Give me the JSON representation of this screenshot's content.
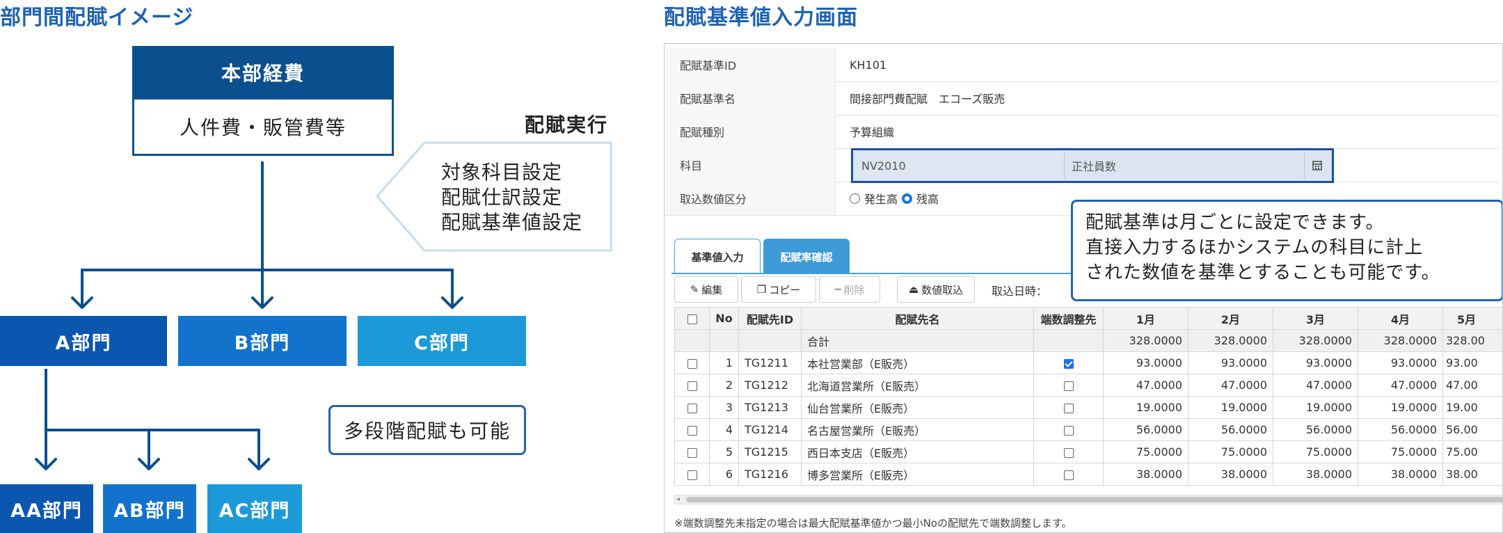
{
  "left": {
    "title": "部門間配賦イメージ",
    "hq": {
      "label": "本部経費",
      "content": "人件費・販管費等"
    },
    "execution_label": "配賦実行",
    "settings": [
      "対象科目設定",
      "配賦仕訳設定",
      "配賦基準値設定"
    ],
    "departments": [
      "A部門",
      "B部門",
      "C部門"
    ],
    "sub_departments": [
      "AA部門",
      "AB部門",
      "AC部門"
    ],
    "multi_stage_note": "多段階配賦も可能",
    "colors": {
      "dark": "#0b4f8e",
      "mid": "#0f6bc4",
      "light": "#1d99d6",
      "arrow": "#0b4f8e"
    }
  },
  "right": {
    "title": "配賦基準値入力画面",
    "form": [
      {
        "label": "配賦基準ID",
        "value": "KH101"
      },
      {
        "label": "配賦基準名",
        "value": "間接部門費配賦　エコーズ販売"
      },
      {
        "label": "配賦種別",
        "value": "予算組織"
      },
      {
        "label": "科目",
        "code": "NV2010",
        "name": "正社員数"
      },
      {
        "label": "取込数値区分",
        "option1": "発生高",
        "option2": "残高"
      }
    ],
    "tabs": [
      "基準値入力",
      "配賦率確認"
    ],
    "toolbar": {
      "edit": "編集",
      "copy": "コピー",
      "delete": "削除",
      "import": "数値取込",
      "import_date_label": "取込日時："
    },
    "callout": [
      "配賦基準は月ごとに設定できます。",
      "直接入力するほかシステムの科目に計上",
      "された数値を基準とすることも可能です。"
    ],
    "table": {
      "headers": [
        "No",
        "配賦先ID",
        "配賦先名",
        "端数調整先",
        "1月",
        "2月",
        "3月",
        "4月",
        "5月"
      ],
      "sum_label": "合計",
      "sum_values": [
        "328.0000",
        "328.0000",
        "328.0000",
        "328.0000",
        "328.00"
      ],
      "rows": [
        {
          "no": "1",
          "id": "TG1211",
          "name": "本社営業部（E販売）",
          "adjust": true,
          "values": [
            "93.0000",
            "93.0000",
            "93.0000",
            "93.0000",
            "93.00"
          ]
        },
        {
          "no": "2",
          "id": "TG1212",
          "name": "北海道営業所（E販売）",
          "adjust": false,
          "values": [
            "47.0000",
            "47.0000",
            "47.0000",
            "47.0000",
            "47.00"
          ]
        },
        {
          "no": "3",
          "id": "TG1213",
          "name": "仙台営業所（E販売）",
          "adjust": false,
          "values": [
            "19.0000",
            "19.0000",
            "19.0000",
            "19.0000",
            "19.00"
          ]
        },
        {
          "no": "4",
          "id": "TG1214",
          "name": "名古屋営業所（E販売）",
          "adjust": false,
          "values": [
            "56.0000",
            "56.0000",
            "56.0000",
            "56.0000",
            "56.00"
          ]
        },
        {
          "no": "5",
          "id": "TG1215",
          "name": "西日本支店（E販売）",
          "adjust": false,
          "values": [
            "75.0000",
            "75.0000",
            "75.0000",
            "75.0000",
            "75.00"
          ]
        },
        {
          "no": "6",
          "id": "TG1216",
          "name": "博多営業所（E販売）",
          "adjust": false,
          "values": [
            "38.0000",
            "38.0000",
            "38.0000",
            "38.0000",
            "38.00"
          ]
        }
      ]
    },
    "footnote": "※端数調整先未指定の場合は最大配賦基準値かつ最小Noの配賦先で端数調整します。"
  }
}
